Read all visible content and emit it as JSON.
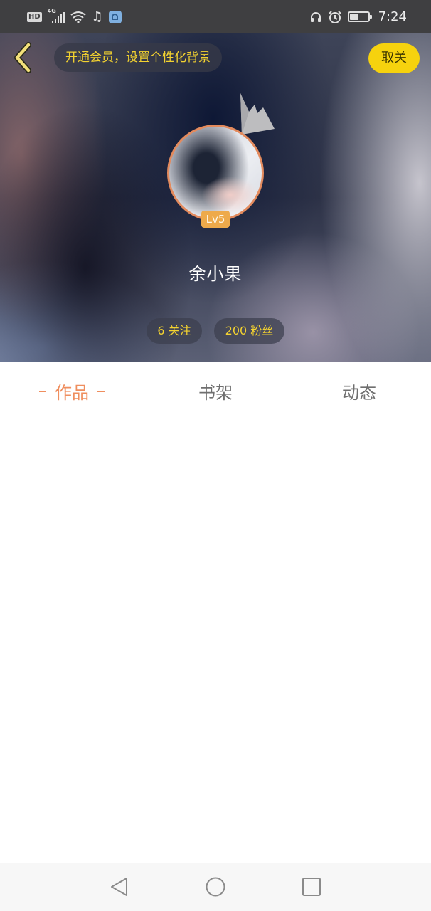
{
  "status_bar": {
    "hd_label": "HD",
    "network_label": "4G",
    "time": "7:24",
    "battery_level": 0.45,
    "left_icons": [
      "hd-icon",
      "signal-icon",
      "wifi-icon",
      "music-note-icon",
      "app-notification-icon"
    ],
    "right_icons": [
      "headphones-icon",
      "alarm-icon",
      "battery-icon"
    ]
  },
  "header": {
    "back_icon": "chevron-left-icon",
    "vip_banner": "开通会员，设置个性化背景",
    "cancel_label": "取关"
  },
  "profile": {
    "level": "Lv5",
    "username": "余小果",
    "following_label": "6 关注",
    "fans_label": "200 粉丝"
  },
  "tabs": [
    {
      "label": "作品",
      "active": true
    },
    {
      "label": "书架",
      "active": false
    },
    {
      "label": "动态",
      "active": false
    }
  ],
  "nav_bar": {
    "icons": [
      "nav-back-icon",
      "nav-home-icon",
      "nav-recent-icon"
    ]
  },
  "colors": {
    "accent_orange": "#ef8e5e",
    "vip_yellow": "#f3d230",
    "cancel_button": "#f6d20e",
    "level_badge": "#eeaa4b",
    "status_bar": "#3f3f41"
  }
}
